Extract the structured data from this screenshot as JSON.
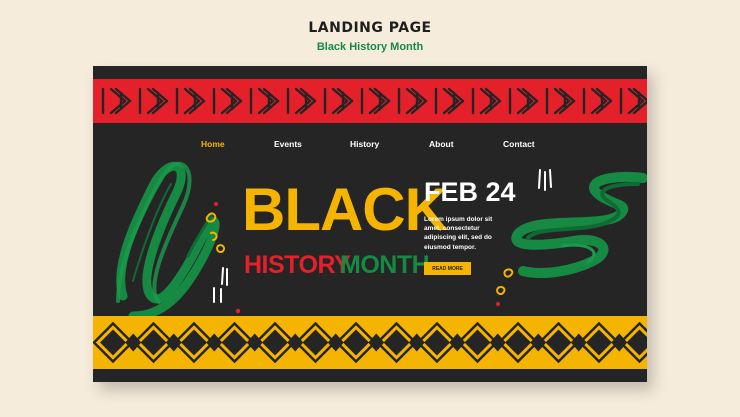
{
  "header": {
    "title": "LANDING PAGE",
    "subtitle": "Black History Month"
  },
  "nav": {
    "items": [
      {
        "label": "Home",
        "active": true
      },
      {
        "label": "Events",
        "active": false
      },
      {
        "label": "History",
        "active": false
      },
      {
        "label": "About",
        "active": false
      },
      {
        "label": "Contact",
        "active": false
      }
    ]
  },
  "hero": {
    "line1": "BLACK",
    "line2a": "HISTORY",
    "line2b": "MONTH"
  },
  "event": {
    "date": "FEB 24",
    "description": "Lorem ipsum dolor sit amet, consectetur adipiscing elit, sed do eiusmod tempor.",
    "button_label": "read more"
  },
  "colors": {
    "background": "#f6ecdc",
    "card": "#262525",
    "red": "#e4202b",
    "yellow": "#f5b400",
    "green": "#168a43",
    "white": "#ffffff"
  },
  "icons": [
    "red-arrow-pattern-icon",
    "yellow-diamond-pattern-icon",
    "green-brush-stroke-icon",
    "yellow-squiggle-icon",
    "white-tick-marks-icon"
  ]
}
